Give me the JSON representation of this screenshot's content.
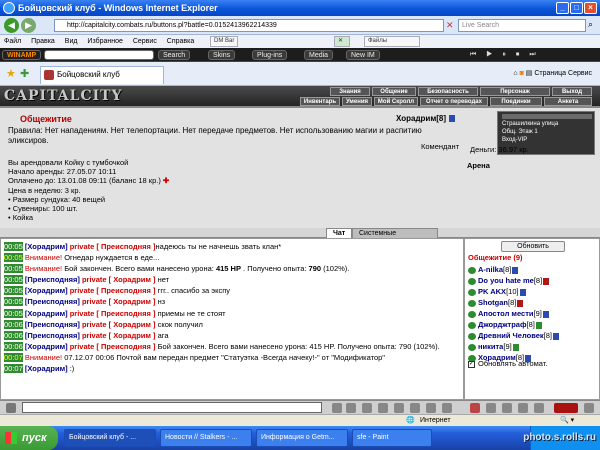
{
  "window": {
    "title": "Бойцовский клуб - Windows Internet Explorer"
  },
  "address": {
    "url": "http://capitalcity.combats.ru/buttons.pl?battle=0.0152413962214339",
    "search_placeholder": "Live Search"
  },
  "menu": [
    "Файл",
    "Правка",
    "Вид",
    "Избранное",
    "Сервис",
    "Справка"
  ],
  "menu_extras": [
    "DM Bar",
    "Файлы"
  ],
  "toolbar2": {
    "winamp": "WINAMP",
    "search": "Search",
    "skins": "Skins",
    "plugins": "Plug-ins",
    "media": "Media",
    "newim": "New IM"
  },
  "tab": {
    "label": "Бойцовский клуб",
    "tools": [
      "Страница",
      "Сервис"
    ]
  },
  "game": {
    "logo": "CAPITALCITY",
    "nav_top": [
      "Знания",
      "Общение",
      "Безопасность",
      "Персонаж",
      "Выход"
    ],
    "nav_bottom": [
      "Инвентарь",
      "Умения",
      "Мой Скролл",
      "Отчет о переводах",
      "Поединки",
      "Анкета"
    ],
    "room_title": "Общежитие",
    "rules": "Правила: Нет нападениям. Нет телепортации. Нет передаче предметов. Нет использованию магии и распитию эликсиров.",
    "character": {
      "name": "Хорадрим",
      "level": "[8]"
    },
    "commandant": "Комендант",
    "money": "Деньги: 36.97 кр.",
    "arena": "Арена",
    "locations": [
      "Страшилкина улица",
      "Общ. Этаж 1",
      "Вход-VIP"
    ],
    "rent": [
      "Вы арендовали Койку с тумбочкой",
      "Начало аренды: 27.05.07 10:11",
      "Оплачено до: 13.01.08 09:11 (баланс 18 кр.)",
      "Цена в неделю: 3 кр.",
      "• Размер сундука: 40 вещей",
      "• Сувениры: 100 шт.",
      "• Койка"
    ]
  },
  "chat_tabs": [
    "Чат",
    "Системные сообщения"
  ],
  "chat": [
    {
      "time": "00:05",
      "tc": "g",
      "parts": [
        [
          "nm",
          "[Хорадрим]"
        ],
        [
          "pr",
          " private [ Преисподняя ]"
        ],
        [
          "",
          "надеюсь ты не начнешь звать клан*"
        ]
      ]
    },
    {
      "time": "00:05",
      "tc": "y",
      "parts": [
        [
          "red",
          "Внимание!"
        ],
        [
          "",
          " Огнедар нуждается в еде..."
        ]
      ]
    },
    {
      "time": "00:05",
      "tc": "g",
      "parts": [
        [
          "red",
          "Внимание!"
        ],
        [
          "",
          " Бой закончен. Всего вами нанесено урона: "
        ],
        [
          "b",
          "415 HP"
        ],
        [
          "",
          " . Получено опыта: "
        ],
        [
          "b",
          "790"
        ],
        [
          "",
          " (102%)."
        ]
      ]
    },
    {
      "time": "00:05",
      "tc": "g",
      "parts": [
        [
          "nm",
          "[Преисподняя]"
        ],
        [
          "pr",
          " private [ Хорадрим ]"
        ],
        [
          "",
          " нет"
        ]
      ]
    },
    {
      "time": "00:05",
      "tc": "g",
      "parts": [
        [
          "nm",
          "[Хорадрим]"
        ],
        [
          "pr",
          " private [ Преисподняя ]"
        ],
        [
          "",
          " ггг.. спасибо за экспу"
        ]
      ]
    },
    {
      "time": "00:05",
      "tc": "g",
      "parts": [
        [
          "nm",
          "[Преисподняя]"
        ],
        [
          "pr",
          " private [ Хорадрим ]"
        ],
        [
          "",
          " нз"
        ]
      ]
    },
    {
      "time": "00:05",
      "tc": "g",
      "parts": [
        [
          "nm",
          "[Хорадрим]"
        ],
        [
          "pr",
          " private [ Преисподняя ]"
        ],
        [
          "",
          " приемы не те стоят"
        ]
      ]
    },
    {
      "time": "00:06",
      "tc": "g",
      "parts": [
        [
          "nm",
          "[Преисподняя]"
        ],
        [
          "pr",
          " private [ Хорадрим ]"
        ],
        [
          "",
          " скок получил"
        ]
      ]
    },
    {
      "time": "00:06",
      "tc": "g",
      "parts": [
        [
          "nm",
          "[Преисподняя]"
        ],
        [
          "pr",
          " private [ Хорадрим ]"
        ],
        [
          "",
          " ага"
        ]
      ]
    },
    {
      "time": "00:06",
      "tc": "g",
      "parts": [
        [
          "nm",
          "[Хорадрим]"
        ],
        [
          "pr",
          " private [ Преисподняя ]"
        ],
        [
          "",
          " Бой закончен. Всего вами нанесено урона: 415 HP. Получено опыта: 790 (102%)."
        ]
      ],
      "wrap": true
    },
    {
      "time": "00:07",
      "tc": "y",
      "parts": [
        [
          "red",
          "Внимание!"
        ],
        [
          "",
          " 07.12.07 00:06 Почтой вам передан предмет \"Статуэтка -Всегда начеку!-\" от \"Модификатор\""
        ]
      ]
    },
    {
      "time": "00:07",
      "tc": "g",
      "parts": [
        [
          "nm",
          "[Хорадрим]"
        ],
        [
          "",
          " :)"
        ]
      ]
    }
  ],
  "online": {
    "refresh_label": "Обновить",
    "title": "Общежитие (9)",
    "users": [
      {
        "name": "A-nilka",
        "level": "[8]",
        "badge": "b-blue"
      },
      {
        "name": "Do you hate me",
        "level": "[8]",
        "badge": "b-red"
      },
      {
        "name": "PK AKX",
        "level": "[10]",
        "badge": "b-blue"
      },
      {
        "name": "Shotgan",
        "level": "[8]",
        "badge": "b-red"
      },
      {
        "name": "Апостол мести",
        "level": "[9]",
        "badge": "b-blue"
      },
      {
        "name": "Джорджтраф",
        "level": "[8]",
        "badge": "b-green"
      },
      {
        "name": "Древний Человек",
        "level": "[8]",
        "badge": "b-blue"
      },
      {
        "name": "никита",
        "level": "[9]",
        "badge": "b-green"
      },
      {
        "name": "Хорадрим",
        "level": "[8]",
        "badge": "b-blue"
      }
    ],
    "autorefresh": "Обновлять автомат."
  },
  "status": {
    "zone": "Интернет"
  },
  "taskbar": {
    "start": "пуск",
    "tasks": [
      "Бойцовский клуб - ...",
      "Новости // Stalkers - ...",
      "Информация о Getm...",
      "sfe - Paint"
    ]
  },
  "watermark": "photo.s.rolls.ru"
}
